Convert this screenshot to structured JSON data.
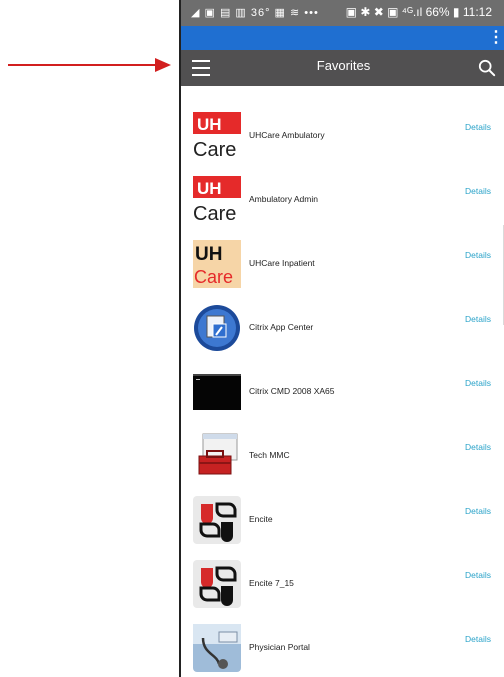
{
  "status": {
    "left": "◢ ▣ ▤ ▥ 36° ▦ ≋ •••",
    "right": "▣ ✱ ✖ ▣ ⁴ᴳ.ıl 66% ▮ 11:12"
  },
  "appbar": {
    "title": "Favorites"
  },
  "items": [
    {
      "label": "UHCare Ambulatory",
      "details": "Details",
      "icon": "uhcare-red"
    },
    {
      "label": "Ambulatory Admin",
      "details": "Details",
      "icon": "uhcare-red"
    },
    {
      "label": "UHCare Inpatient",
      "details": "Details",
      "icon": "uhcare-beige"
    },
    {
      "label": "Citrix App Center",
      "details": "Details",
      "icon": "citrix-globe"
    },
    {
      "label": "Citrix CMD 2008 XA65",
      "details": "Details",
      "icon": "cmd-window"
    },
    {
      "label": "Tech MMC",
      "details": "Details",
      "icon": "toolbox"
    },
    {
      "label": "Encite",
      "details": "Details",
      "icon": "encite"
    },
    {
      "label": "Encite 7_15",
      "details": "Details",
      "icon": "encite"
    },
    {
      "label": "Physician Portal",
      "details": "Details",
      "icon": "stethoscope"
    }
  ],
  "colors": {
    "appbar": "#515051",
    "bluebar": "#1f6fd1",
    "link": "#2aa3c9",
    "arrow": "#d21f1f"
  }
}
